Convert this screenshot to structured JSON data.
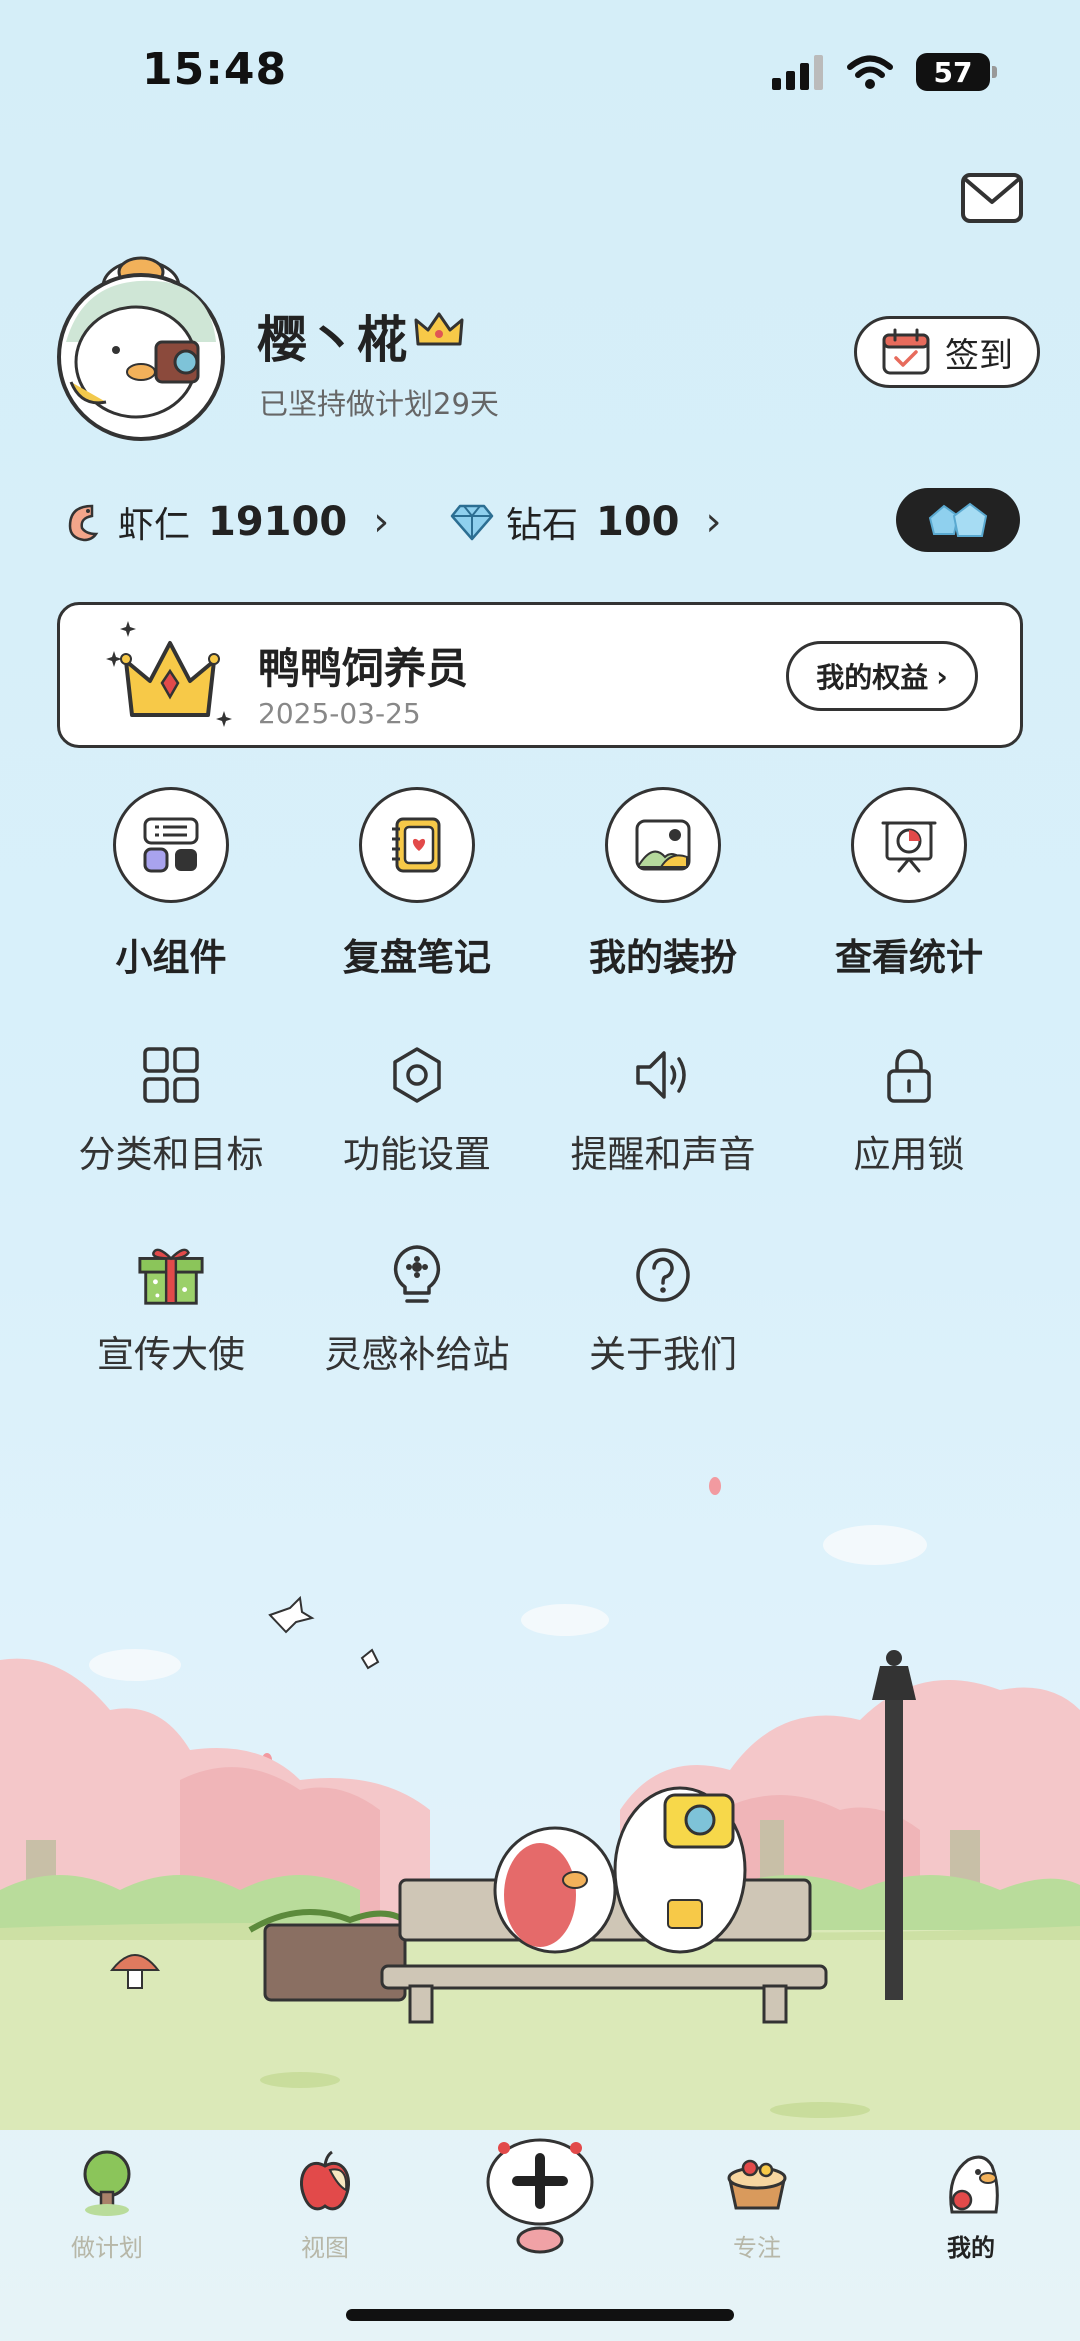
{
  "status": {
    "time": "15:48",
    "battery": "57"
  },
  "profile": {
    "name": "樱丶椛",
    "streak": "已坚持做计划29天",
    "signin_label": "签到"
  },
  "currency": {
    "shrimp": {
      "label": "虾仁",
      "value": "19100"
    },
    "diamond": {
      "label": "钻石",
      "value": "100"
    }
  },
  "vip": {
    "title": "鸭鸭饲养员",
    "date": "2025-03-25",
    "button": "我的权益"
  },
  "features": [
    {
      "label": "小组件"
    },
    {
      "label": "复盘笔记"
    },
    {
      "label": "我的装扮"
    },
    {
      "label": "查看统计"
    }
  ],
  "menu": [
    {
      "label": "分类和目标"
    },
    {
      "label": "功能设置"
    },
    {
      "label": "提醒和声音"
    },
    {
      "label": "应用锁"
    },
    {
      "label": "宣传大使"
    },
    {
      "label": "灵感补给站"
    },
    {
      "label": "关于我们"
    }
  ],
  "nav": [
    {
      "label": "做计划"
    },
    {
      "label": "视图"
    },
    {
      "label": "专注"
    },
    {
      "label": "我的"
    }
  ],
  "colors": {
    "background": "#d9f0fa",
    "grass": "#dbe9b8",
    "blossom": "#f4c7c9",
    "accent": "#222222"
  }
}
